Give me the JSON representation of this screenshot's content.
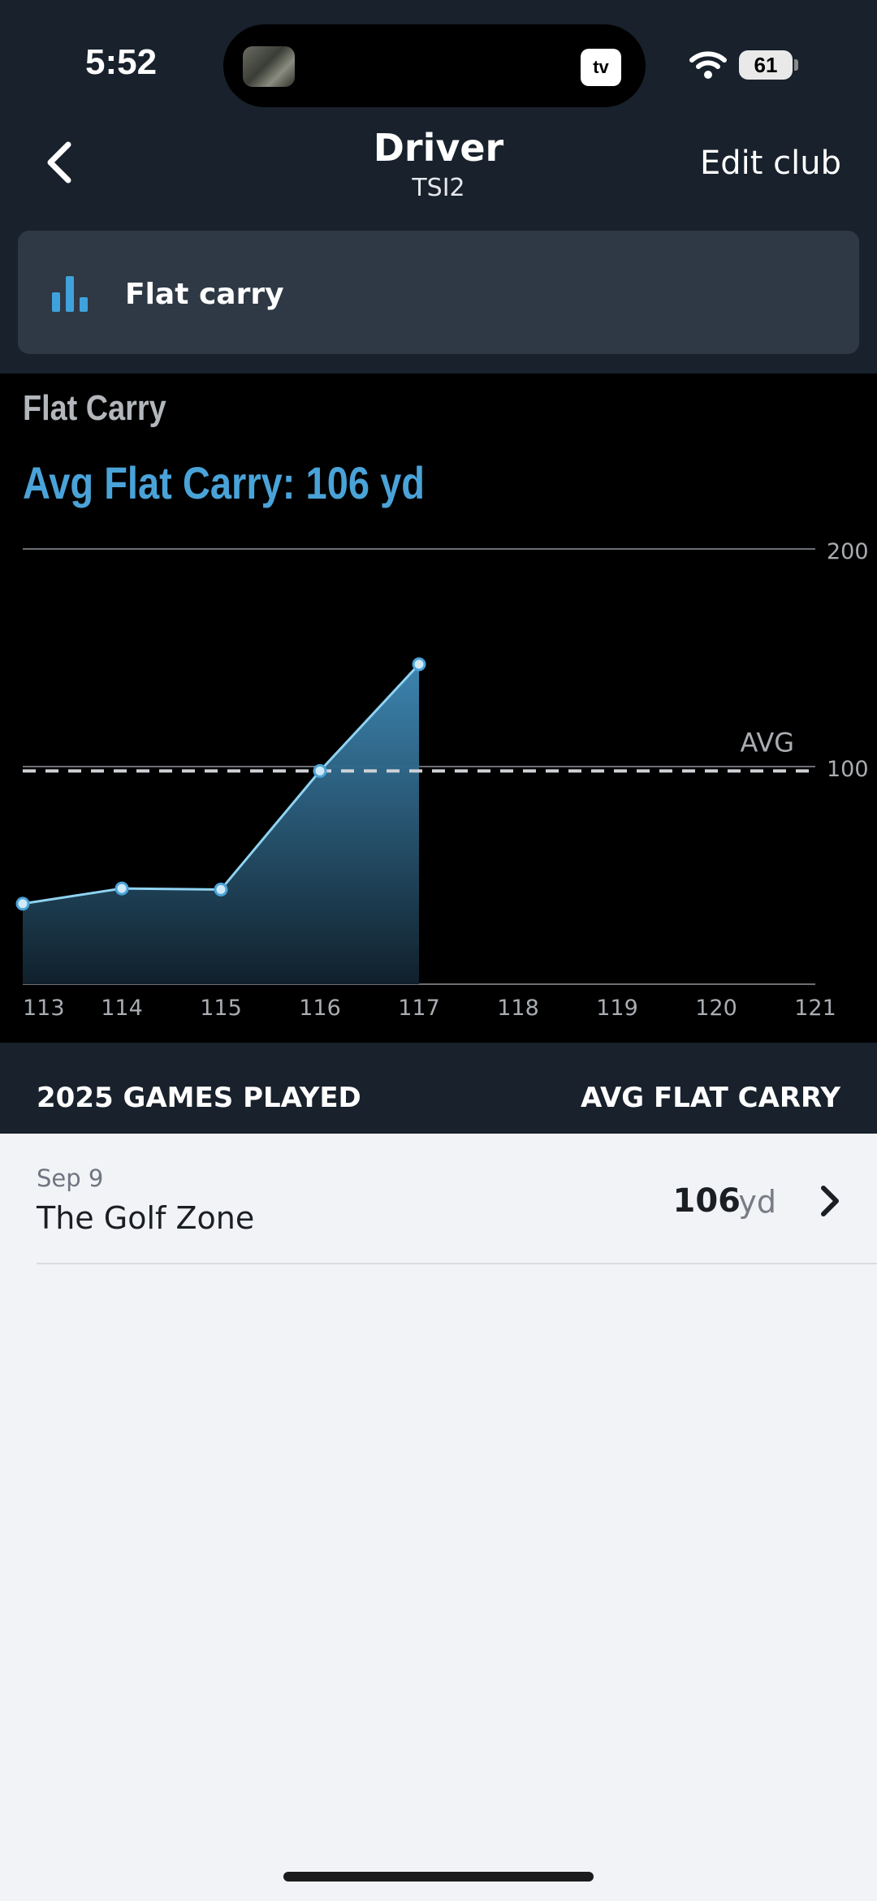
{
  "status_bar": {
    "time": "5:52",
    "island_app": "tv",
    "battery": "61"
  },
  "header": {
    "title": "Driver",
    "subtitle": "TSI2",
    "edit_label": "Edit club"
  },
  "metric_selector": {
    "label": "Flat carry",
    "icon": "bar-chart-icon"
  },
  "chart_heading": "Flat Carry",
  "chart_avg_text": "Avg Flat Carry: 106 yd",
  "chart_data": {
    "type": "area",
    "title": "Flat Carry",
    "subtitle": "Avg Flat Carry: 106 yd",
    "x": [
      113,
      114,
      115,
      116,
      117
    ],
    "x_ticks": [
      "113",
      "114",
      "115",
      "116",
      "117",
      "118",
      "119",
      "120",
      "121"
    ],
    "xlim": [
      113,
      121
    ],
    "series": [
      {
        "values": [
          37,
          44,
          43.5,
          98,
          147
        ]
      }
    ],
    "y_ticks": [
      "100",
      "200"
    ],
    "ylim": [
      0,
      200
    ],
    "reference_line": {
      "label": "AVG",
      "value": 98
    },
    "grid": true,
    "colors": {
      "line": "#8fd3f2",
      "fill_top": "#3f8bb8",
      "fill_bottom": "#10202b",
      "avg_line": "#cfd3d8"
    }
  },
  "games_section": {
    "left_header": "2025 GAMES PLAYED",
    "right_header": "AVG FLAT CARRY",
    "rows": [
      {
        "date": "Sep 9",
        "venue": "The Golf Zone",
        "value": "106",
        "unit": "yd"
      }
    ]
  },
  "colors": {
    "header_bg": "#18212c",
    "selector_bg": "#2e3945",
    "accent": "#4aa3d8",
    "list_bg": "#f2f3f6"
  }
}
